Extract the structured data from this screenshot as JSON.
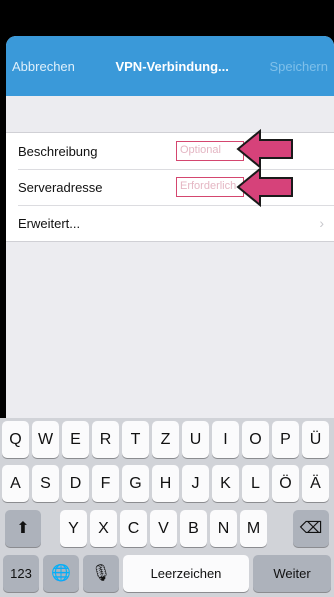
{
  "navbar": {
    "cancel_label": "Abbrechen",
    "title": "VPN-Verbindung...",
    "save_label": "Speichern"
  },
  "form": {
    "description_label": "Beschreibung",
    "description_placeholder": "Optional",
    "server_label": "Serveradresse",
    "server_placeholder": "Erforderlich",
    "advanced_label": "Erweitert...",
    "chevron": "›"
  },
  "keyboard": {
    "row1": [
      "Q",
      "W",
      "E",
      "R",
      "T",
      "Z",
      "U",
      "I",
      "O",
      "P",
      "Ü"
    ],
    "row2": [
      "A",
      "S",
      "D",
      "F",
      "G",
      "H",
      "J",
      "K",
      "L",
      "Ö",
      "Ä"
    ],
    "row3": [
      "Y",
      "X",
      "C",
      "V",
      "B",
      "N",
      "M"
    ],
    "shift_icon": "⬆",
    "backspace_icon": "⌫",
    "numbers_label": "123",
    "globe_icon": "🌐",
    "mic_icon": "🎙",
    "space_label": "Leerzeichen",
    "return_label": "Weiter"
  },
  "colors": {
    "nav_bar": "#3a99d9",
    "field_highlight": "#d4466f",
    "annotation_arrow": "#d6427a"
  }
}
